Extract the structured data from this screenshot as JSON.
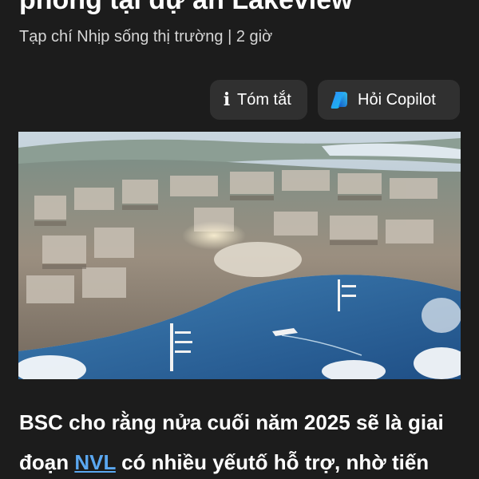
{
  "article": {
    "headline_fragment": "phòng tại dự án Lakeview",
    "source": "Tạp chí Nhịp sống thị trường",
    "separator": "|",
    "age": "2 giờ"
  },
  "actions": {
    "summary_label": "Tóm tắt",
    "copilot_label": "Hỏi Copilot"
  },
  "body": {
    "line1": "BSC cho rằng nửa cuối năm 2025 sẽ là giai",
    "line2_before": "đoạn ",
    "line2_link": "NVL",
    "line2_after": " có nhiều yếutố  hỗ trợ, nhờ tiến"
  },
  "colors": {
    "background": "#1c1c1c",
    "chip": "#303030",
    "link": "#5aa7f0"
  },
  "icons": {
    "summary": "info-icon",
    "copilot": "copilot-icon"
  }
}
